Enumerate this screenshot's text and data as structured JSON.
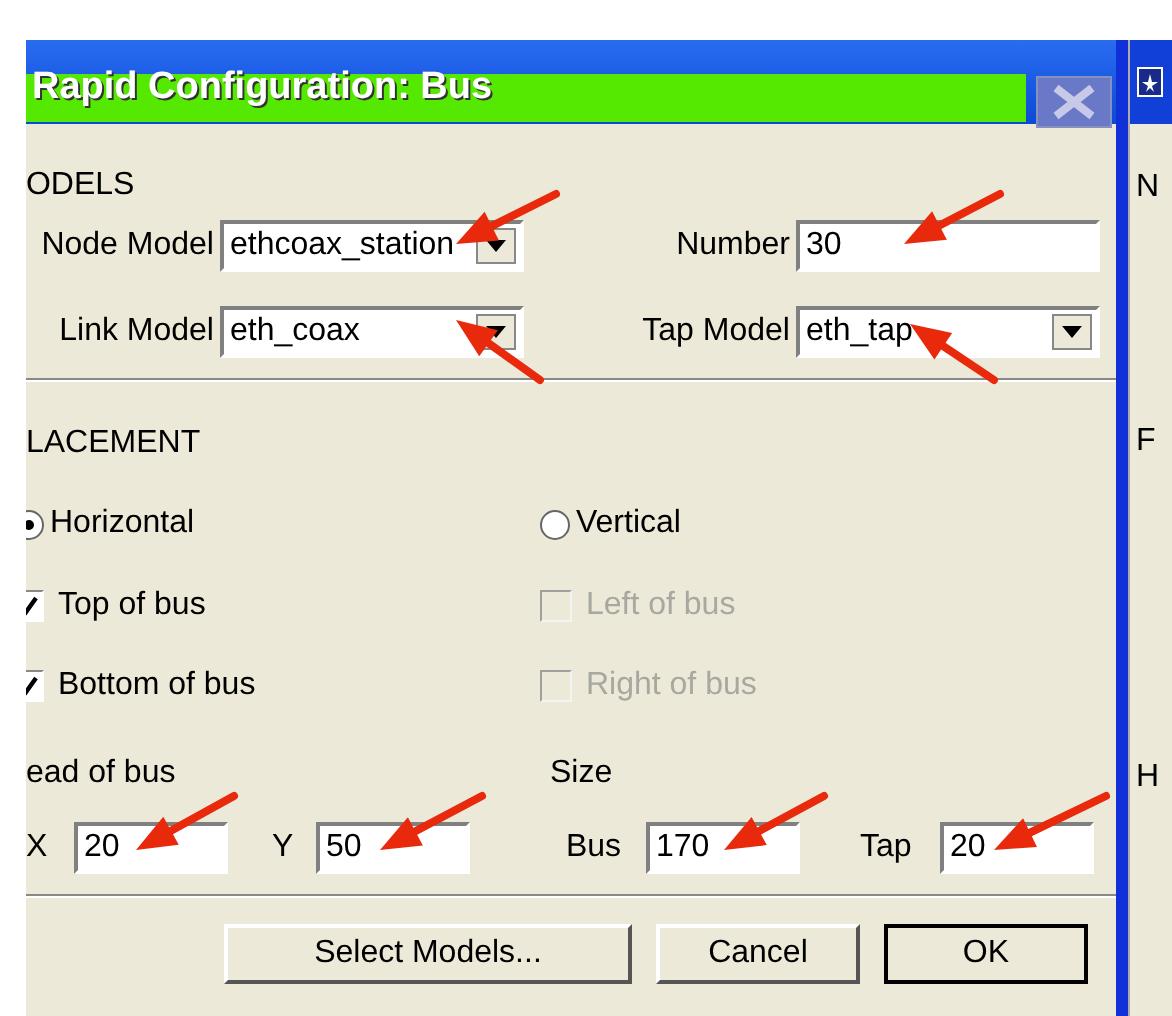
{
  "window": {
    "title": "Rapid Configuration: Bus"
  },
  "models": {
    "heading": "ODELS",
    "fields": [
      {
        "label": "Node Model",
        "value": "ethcoax_station",
        "kind": "dropdown"
      },
      {
        "label": "Number",
        "value": "30",
        "kind": "text"
      },
      {
        "label": "Link Model",
        "value": "eth_coax",
        "kind": "dropdown"
      },
      {
        "label": "Tap Model",
        "value": "eth_tap",
        "kind": "dropdown"
      }
    ]
  },
  "placement": {
    "heading": "LACEMENT",
    "orientation": [
      {
        "label": "Horizontal",
        "selected": true
      },
      {
        "label": "Vertical",
        "selected": false
      }
    ],
    "sides": [
      {
        "label": "Top of bus",
        "checked": true,
        "disabled": false
      },
      {
        "label": "Left of bus",
        "checked": false,
        "disabled": true
      },
      {
        "label": "Bottom of bus",
        "checked": true,
        "disabled": false
      },
      {
        "label": "Right of bus",
        "checked": false,
        "disabled": true
      }
    ]
  },
  "head": {
    "heading": "ead of bus",
    "fields": [
      {
        "label": "X",
        "value": "20"
      },
      {
        "label": "Y",
        "value": "50"
      }
    ]
  },
  "size": {
    "heading": "Size",
    "fields": [
      {
        "label": "Bus",
        "value": "170"
      },
      {
        "label": "Tap",
        "value": "20"
      }
    ]
  },
  "buttons": [
    {
      "label": "Select Models...",
      "default": false
    },
    {
      "label": "Cancel",
      "default": false
    },
    {
      "label": "OK",
      "default": true
    }
  ],
  "side_window": {
    "letters": [
      "N",
      "F",
      "H"
    ]
  }
}
